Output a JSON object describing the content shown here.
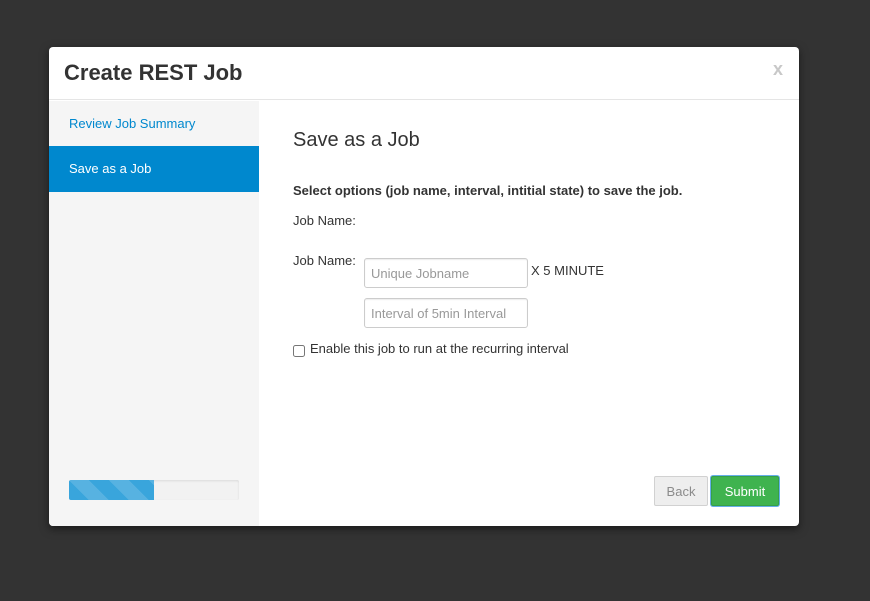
{
  "modal": {
    "title": "Create REST Job",
    "close_label": "x"
  },
  "sidebar": {
    "items": [
      {
        "label": "Review Job Summary",
        "active": false
      },
      {
        "label": "Save as a Job",
        "active": true
      }
    ],
    "progress_fraction": 0.5
  },
  "content": {
    "step_title": "Save as a Job",
    "instructions": "Select options (job name, interval, intitial state) to save the job.",
    "job_name": {
      "label": "Job Name:",
      "value": "",
      "placeholder": "Unique Jobname"
    },
    "interval": {
      "label": "Job Name:",
      "value": "",
      "placeholder": "Interval of 5min Interval",
      "suffix": "X 5 MINUTE"
    },
    "enable_checkbox": {
      "label": "Enable this job to run at the recurring interval",
      "checked": false
    }
  },
  "footer": {
    "back_label": "Back",
    "submit_label": "Submit"
  },
  "colors": {
    "backdrop": "#333333",
    "accent": "#0088ce",
    "progress": "#39a5dc",
    "submit": "#3fb34f"
  }
}
